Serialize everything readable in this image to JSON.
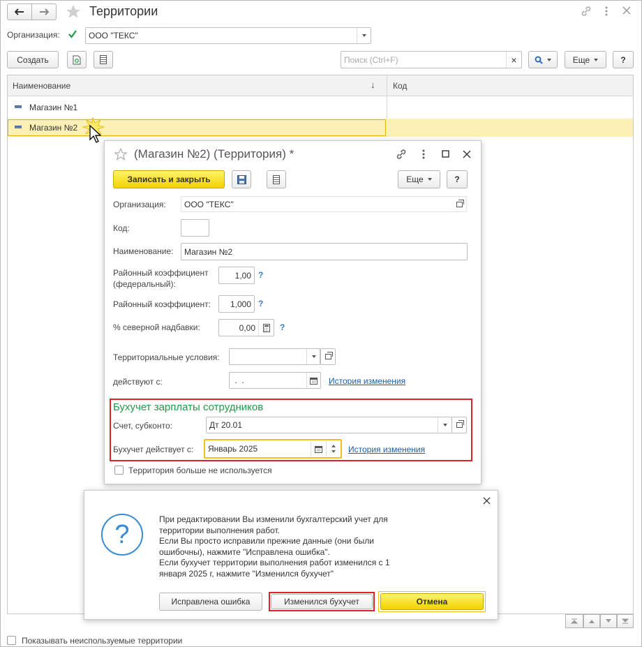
{
  "window": {
    "title": "Территории",
    "org_label": "Организация:",
    "org_value": "ООО \"ТЕКС\""
  },
  "toolbar": {
    "create_label": "Создать",
    "search_placeholder": "Поиск (Ctrl+F)",
    "search_clear": "×",
    "more_label": "Еще",
    "help_label": "?"
  },
  "list": {
    "columns": [
      "Наименование",
      "Код"
    ],
    "sort_indicator": "↓",
    "rows": [
      {
        "name": "Магазин №1",
        "code": ""
      },
      {
        "name": "Магазин №2",
        "code": ""
      }
    ]
  },
  "bottom": {
    "show_unused_label": "Показывать неиспользуемые территории"
  },
  "form": {
    "title": "(Магазин №2) (Территория) *",
    "save_close_label": "Записать и закрыть",
    "more_label": "Еще",
    "help_label": "?",
    "org_label": "Организация:",
    "org_value": "ООО \"ТЕКС\"",
    "code_label": "Код:",
    "code_value": "",
    "name_label": "Наименование:",
    "name_value": "Магазин №2",
    "coef_fed_label_1": "Районный коэффициент",
    "coef_fed_label_2": "(федеральный):",
    "coef_fed_value": "1,00",
    "coef_label": "Районный коэффициент:",
    "coef_value": "1,000",
    "north_label": "% северной надбавки:",
    "north_value": "0,00",
    "q_mark": "?",
    "terr_cond_label": "Территориальные условия:",
    "terr_cond_value": "",
    "valid_from_label": "действуют с:",
    "valid_from_value": " .  .",
    "history_label": "История изменения",
    "accounting_header": "Бухучет зарплаты сотрудников",
    "account_label": "Счет, субконто:",
    "account_value": "Дт 20.01",
    "acc_from_label": "Бухучет действует с:",
    "acc_from_value": "Январь 2025",
    "acc_history_label": "История изменения",
    "unused_label": "Территория больше не используется"
  },
  "dialog": {
    "message_lines": [
      "При редактировании Вы изменили бухгалтерский учет для",
      "территории выполнения работ.",
      "Если Вы просто исправили прежние данные (они были",
      "ошибочны), нажмите \"Исправлена ошибка\".",
      "Если бухучет территории выполнения работ изменился с 1",
      "января 2025 г, нажмите \"Изменился бухучет\""
    ],
    "btn_fixed": "Исправлена ошибка",
    "btn_changed": "Изменился бухучет",
    "btn_cancel": "Отмена",
    "question_mark": "?"
  },
  "colors": {
    "accent_green": "#1e9a48",
    "highlight_red": "#e0202a",
    "selected_row": "#fdf0b4",
    "link_blue": "#1d5b9b"
  }
}
